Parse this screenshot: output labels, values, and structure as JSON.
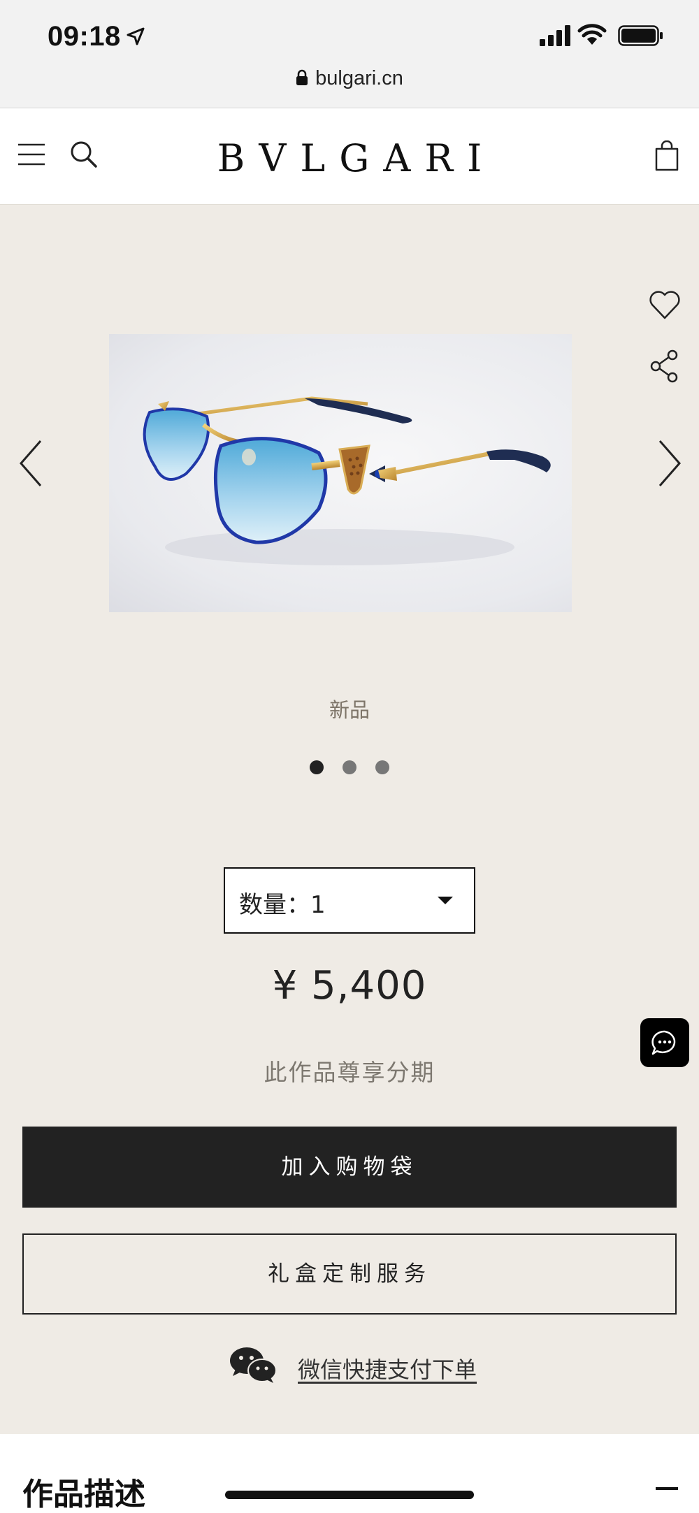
{
  "status_bar": {
    "time": "09:18",
    "url": "bulgari.cn"
  },
  "header": {
    "logo": "BVLGARI",
    "icons": [
      "menu-icon",
      "search-icon",
      "shopping-bag-icon"
    ]
  },
  "product": {
    "badge": "新品",
    "gallery_dots": 3,
    "active_dot": 1,
    "quantity_label": "数量：",
    "quantity_value": "1",
    "price": "¥ 5,400",
    "installment_text": "此作品尊享分期",
    "add_to_bag": "加入购物袋",
    "gift_box_service": "礼盒定制服务",
    "wechat_pay": "微信快捷支付下单"
  },
  "description": {
    "title": "作品描述"
  },
  "colors": {
    "page_bg": "#efebe5",
    "primary_button": "#222222",
    "muted_text": "#7d7468"
  }
}
